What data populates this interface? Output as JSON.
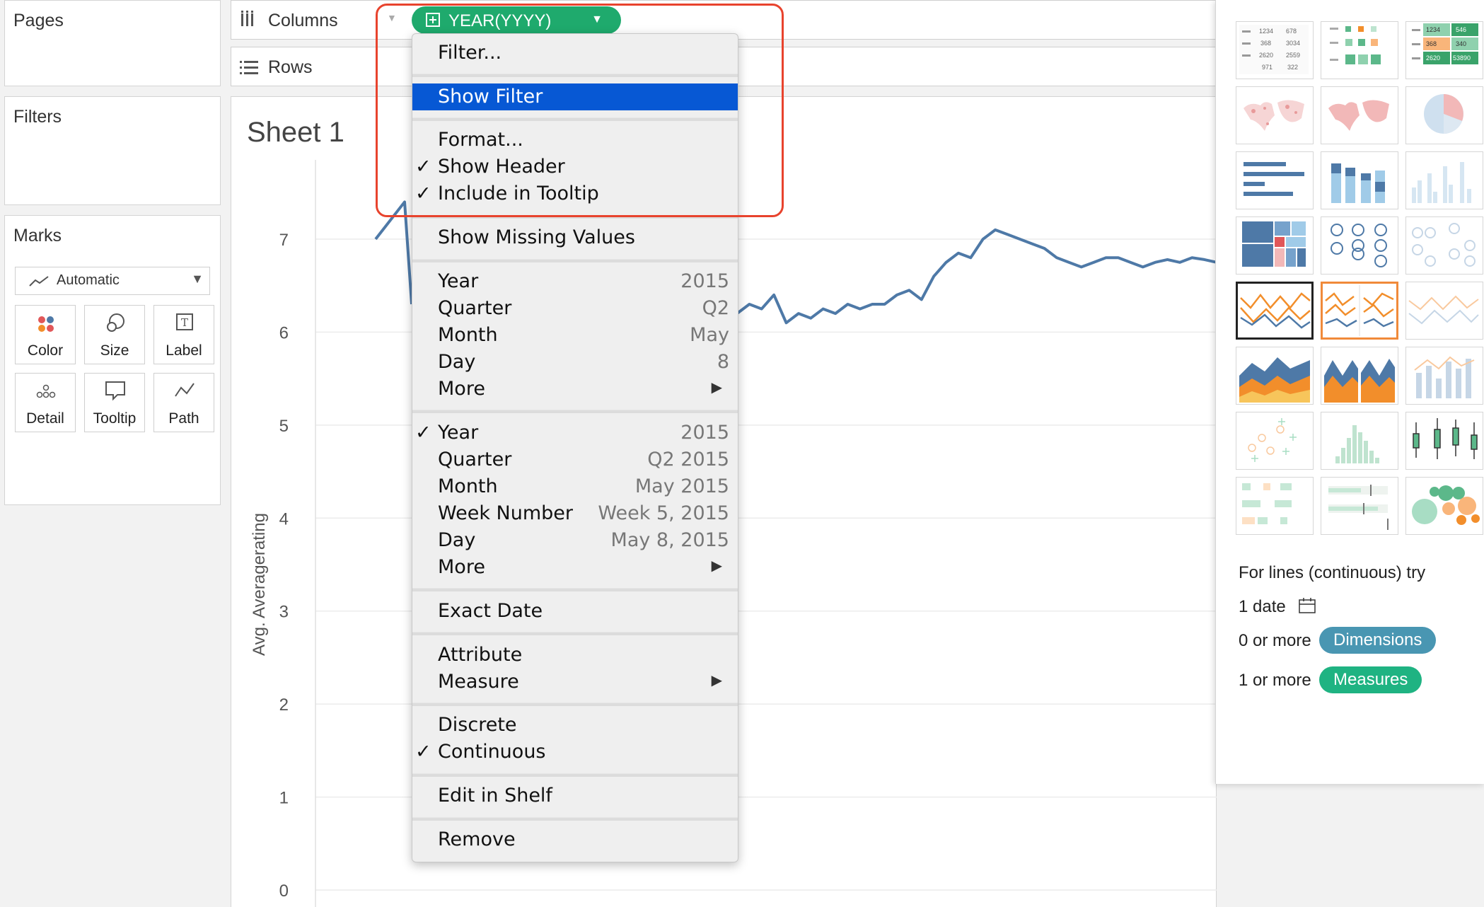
{
  "panels": {
    "pages": "Pages",
    "filters": "Filters",
    "marks": "Marks"
  },
  "marks": {
    "type": "Automatic",
    "buttons": [
      {
        "label": "Color",
        "icon": "color-icon"
      },
      {
        "label": "Size",
        "icon": "size-icon"
      },
      {
        "label": "Label",
        "icon": "label-icon"
      },
      {
        "label": "Detail",
        "icon": "detail-icon"
      },
      {
        "label": "Tooltip",
        "icon": "tooltip-icon"
      },
      {
        "label": "Path",
        "icon": "path-icon"
      }
    ]
  },
  "shelves": {
    "columns": "Columns",
    "rows": "Rows",
    "pill": "YEAR(YYYY)"
  },
  "sheet": {
    "title": "Sheet 1"
  },
  "menu": {
    "filter": "Filter...",
    "show_filter": "Show Filter",
    "format": "Format...",
    "show_header": "Show Header",
    "include_tooltip": "Include in Tooltip",
    "show_missing": "Show Missing Values",
    "date_parts": [
      {
        "label": "Year",
        "value": "2015"
      },
      {
        "label": "Quarter",
        "value": "Q2"
      },
      {
        "label": "Month",
        "value": "May"
      },
      {
        "label": "Day",
        "value": "8"
      },
      {
        "label": "More",
        "value": ""
      }
    ],
    "date_values": [
      {
        "label": "Year",
        "value": "2015"
      },
      {
        "label": "Quarter",
        "value": "Q2 2015"
      },
      {
        "label": "Month",
        "value": "May 2015"
      },
      {
        "label": "Week Number",
        "value": "Week 5, 2015"
      },
      {
        "label": "Day",
        "value": "May 8, 2015"
      },
      {
        "label": "More",
        "value": ""
      }
    ],
    "exact_date": "Exact Date",
    "attribute": "Attribute",
    "measure": "Measure",
    "discrete": "Discrete",
    "continuous": "Continuous",
    "edit_in_shelf": "Edit in Shelf",
    "remove": "Remove",
    "check": "✓",
    "arrow": "▶"
  },
  "show_me": {
    "hint": "For lines (continuous) try",
    "req1_text": "1 date",
    "req2_text": "0 or more",
    "req2_pill": "Dimensions",
    "req3_text": "1 or more",
    "req3_pill": "Measures",
    "table_numbers": [
      "1234",
      "678",
      "368",
      "3034",
      "2620",
      "2559",
      "971",
      "322"
    ],
    "highlight_numbers": [
      "1234",
      "546",
      "368",
      "340",
      "2620",
      "53890"
    ]
  },
  "colors": {
    "pill": "#1faa6d",
    "line": "#4e79a7",
    "highlight": "#0758d4",
    "annotation": "#e8432d",
    "dimensions": "#4996b2",
    "measures": "#1fb382"
  },
  "chart_data": {
    "type": "line",
    "title": "Sheet 1",
    "xlabel": "",
    "ylabel": "Avg. Averagerating",
    "yticks": [
      "0",
      "1",
      "2",
      "3",
      "4",
      "5",
      "6",
      "7"
    ],
    "ylim": [
      0,
      7.9
    ],
    "grid": true,
    "series": [
      {
        "values_left": [
          7.0,
          7.4,
          6.3
        ],
        "values_right": [
          6.2,
          6.3,
          6.25,
          6.4,
          6.1,
          6.2,
          6.15,
          6.25,
          6.2,
          6.3,
          6.25,
          6.3,
          6.3,
          6.4,
          6.45,
          6.35,
          6.6,
          6.75,
          6.85,
          6.8,
          7.0,
          7.1,
          7.05,
          7.0,
          6.95,
          6.9,
          6.8,
          6.75,
          6.7,
          6.75,
          6.8,
          6.8,
          6.75,
          6.7,
          6.75,
          6.78,
          6.75,
          6.8,
          6.78,
          6.75
        ]
      }
    ]
  }
}
